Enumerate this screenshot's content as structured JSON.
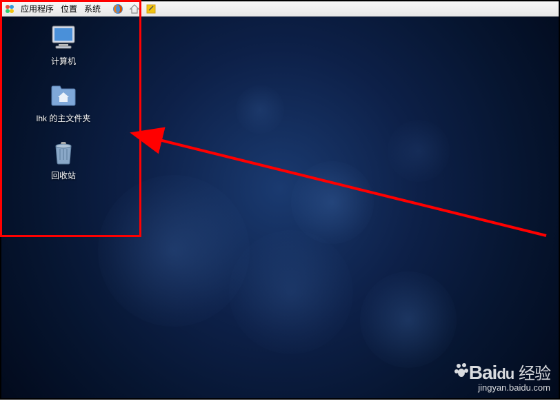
{
  "panel": {
    "menu": {
      "applications": "应用程序",
      "places": "位置",
      "system": "系统"
    }
  },
  "desktop": {
    "icons": {
      "computer": "计算机",
      "home": "lhk 的主文件夹",
      "trash": "回收站"
    }
  },
  "watermark": {
    "brand": "Bai",
    "brand2": "经验",
    "url": "jingyan.baidu.com"
  },
  "annotation": {
    "color": "#ff0000"
  }
}
